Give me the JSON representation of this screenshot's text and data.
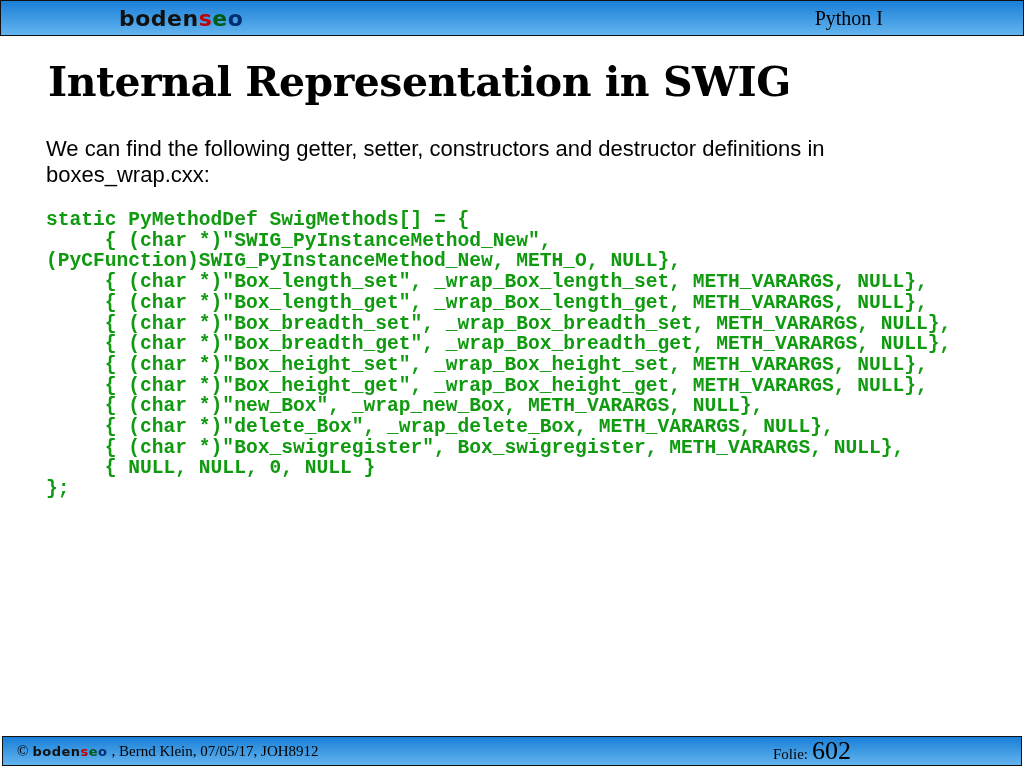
{
  "header": {
    "logo": [
      {
        "text": "boden",
        "color": "#111111"
      },
      {
        "text": "s",
        "color": "#c00000"
      },
      {
        "text": "e",
        "color": "#005a18"
      },
      {
        "text": "o",
        "color": "#002f70"
      }
    ],
    "course": "Python I"
  },
  "title": "Internal Representation in SWIG",
  "intro": "We can find the following getter, setter, constructors and destructor definitions in boxes_wrap.cxx:",
  "code": [
    "static PyMethodDef SwigMethods[] = {",
    "     { (char *)\"SWIG_PyInstanceMethod_New\",",
    "(PyCFunction)SWIG_PyInstanceMethod_New, METH_O, NULL},",
    "     { (char *)\"Box_length_set\", _wrap_Box_length_set, METH_VARARGS, NULL},",
    "     { (char *)\"Box_length_get\", _wrap_Box_length_get, METH_VARARGS, NULL},",
    "     { (char *)\"Box_breadth_set\", _wrap_Box_breadth_set, METH_VARARGS, NULL},",
    "     { (char *)\"Box_breadth_get\", _wrap_Box_breadth_get, METH_VARARGS, NULL},",
    "     { (char *)\"Box_height_set\", _wrap_Box_height_set, METH_VARARGS, NULL},",
    "     { (char *)\"Box_height_get\", _wrap_Box_height_get, METH_VARARGS, NULL},",
    "     { (char *)\"new_Box\", _wrap_new_Box, METH_VARARGS, NULL},",
    "     { (char *)\"delete_Box\", _wrap_delete_Box, METH_VARARGS, NULL},",
    "     { (char *)\"Box_swigregister\", Box_swigregister, METH_VARARGS, NULL},",
    "     { NULL, NULL, 0, NULL }",
    "};"
  ],
  "footer": {
    "copyright": "©",
    "logo": [
      {
        "text": "boden",
        "color": "#111111"
      },
      {
        "text": "s",
        "color": "#c00000"
      },
      {
        "text": "e",
        "color": "#005a18"
      },
      {
        "text": "o",
        "color": "#002f70"
      }
    ],
    "credits": ", Bernd Klein, 07/05/17, JOH8912",
    "slide_label": "Folie:",
    "slide_number": "602"
  }
}
